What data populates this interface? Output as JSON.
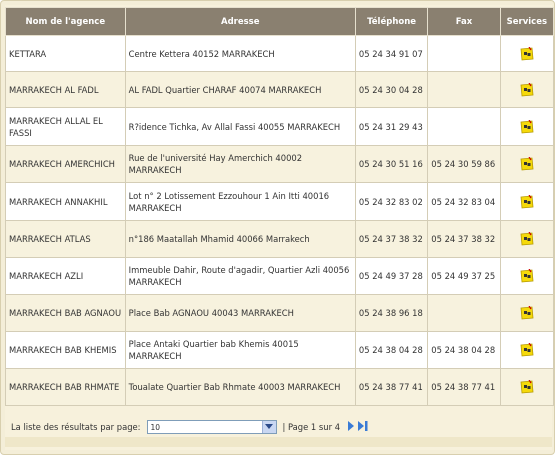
{
  "columns": {
    "name": "Nom de l'agence",
    "address": "Adresse",
    "phone": "Téléphone",
    "fax": "Fax",
    "services": "Services"
  },
  "rows": [
    {
      "name": "KETTARA",
      "address": "Centre Kettera 40152 MARRAKECH",
      "phone": "05 24 34 91 07",
      "fax": ""
    },
    {
      "name": "MARRAKECH AL FADL",
      "address": "AL FADL Quartier CHARAF 40074 MARRAKECH",
      "phone": "05 24 30 04 28",
      "fax": ""
    },
    {
      "name": "MARRAKECH ALLAL EL FASSI",
      "address": "R?idence Tichka, Av Allal Fassi 40055 MARRAKECH",
      "phone": "05 24 31 29 43",
      "fax": ""
    },
    {
      "name": "MARRAKECH AMERCHICH",
      "address": "Rue de l'université Hay Amerchich 40002 MARRAKECH",
      "phone": "05 24 30 51 16",
      "fax": "05 24 30 59 86"
    },
    {
      "name": "MARRAKECH ANNAKHIL",
      "address": "Lot n° 2 Lotissement Ezzouhour 1 Ain Itti 40016 MARRAKECH",
      "phone": "05 24 32 83 02",
      "fax": "05 24 32 83 04"
    },
    {
      "name": "MARRAKECH ATLAS",
      "address": "n°186 Maatallah Mhamid 40066 Marrakech",
      "phone": "05 24 37 38 32",
      "fax": "05 24 37 38 32"
    },
    {
      "name": "MARRAKECH AZLI",
      "address": "Immeuble Dahir, Route d'agadir, Quartier Azli 40056 MARRAKECH",
      "phone": "05 24 49 37 28",
      "fax": "05 24 49 37 25"
    },
    {
      "name": "MARRAKECH BAB AGNAOU",
      "address": "Place Bab AGNAOU 40043 MARRAKECH",
      "phone": "05 24 38 96 18",
      "fax": ""
    },
    {
      "name": "MARRAKECH BAB KHEMIS",
      "address": "Place Antaki Quartier bab Khemis 40015 MARRAKECH",
      "phone": "05 24 38 04 28",
      "fax": "05 24 38 04 28"
    },
    {
      "name": "MARRAKECH BAB RHMATE",
      "address": "Toualate Quartier Bab Rhmate 40003 MARRAKECH",
      "phone": "05 24 38 77 41",
      "fax": "05 24 38 77 41"
    }
  ],
  "footer": {
    "per_page_label": "La liste des résultats par page:",
    "per_page_value": "10",
    "page_info": "| Page 1 sur 4"
  },
  "colors": {
    "header_bg": "#8a8070",
    "row_alt_bg": "#f7f2de",
    "icon_yellow": "#f5d90a",
    "nav_blue": "#3a7bd5"
  }
}
